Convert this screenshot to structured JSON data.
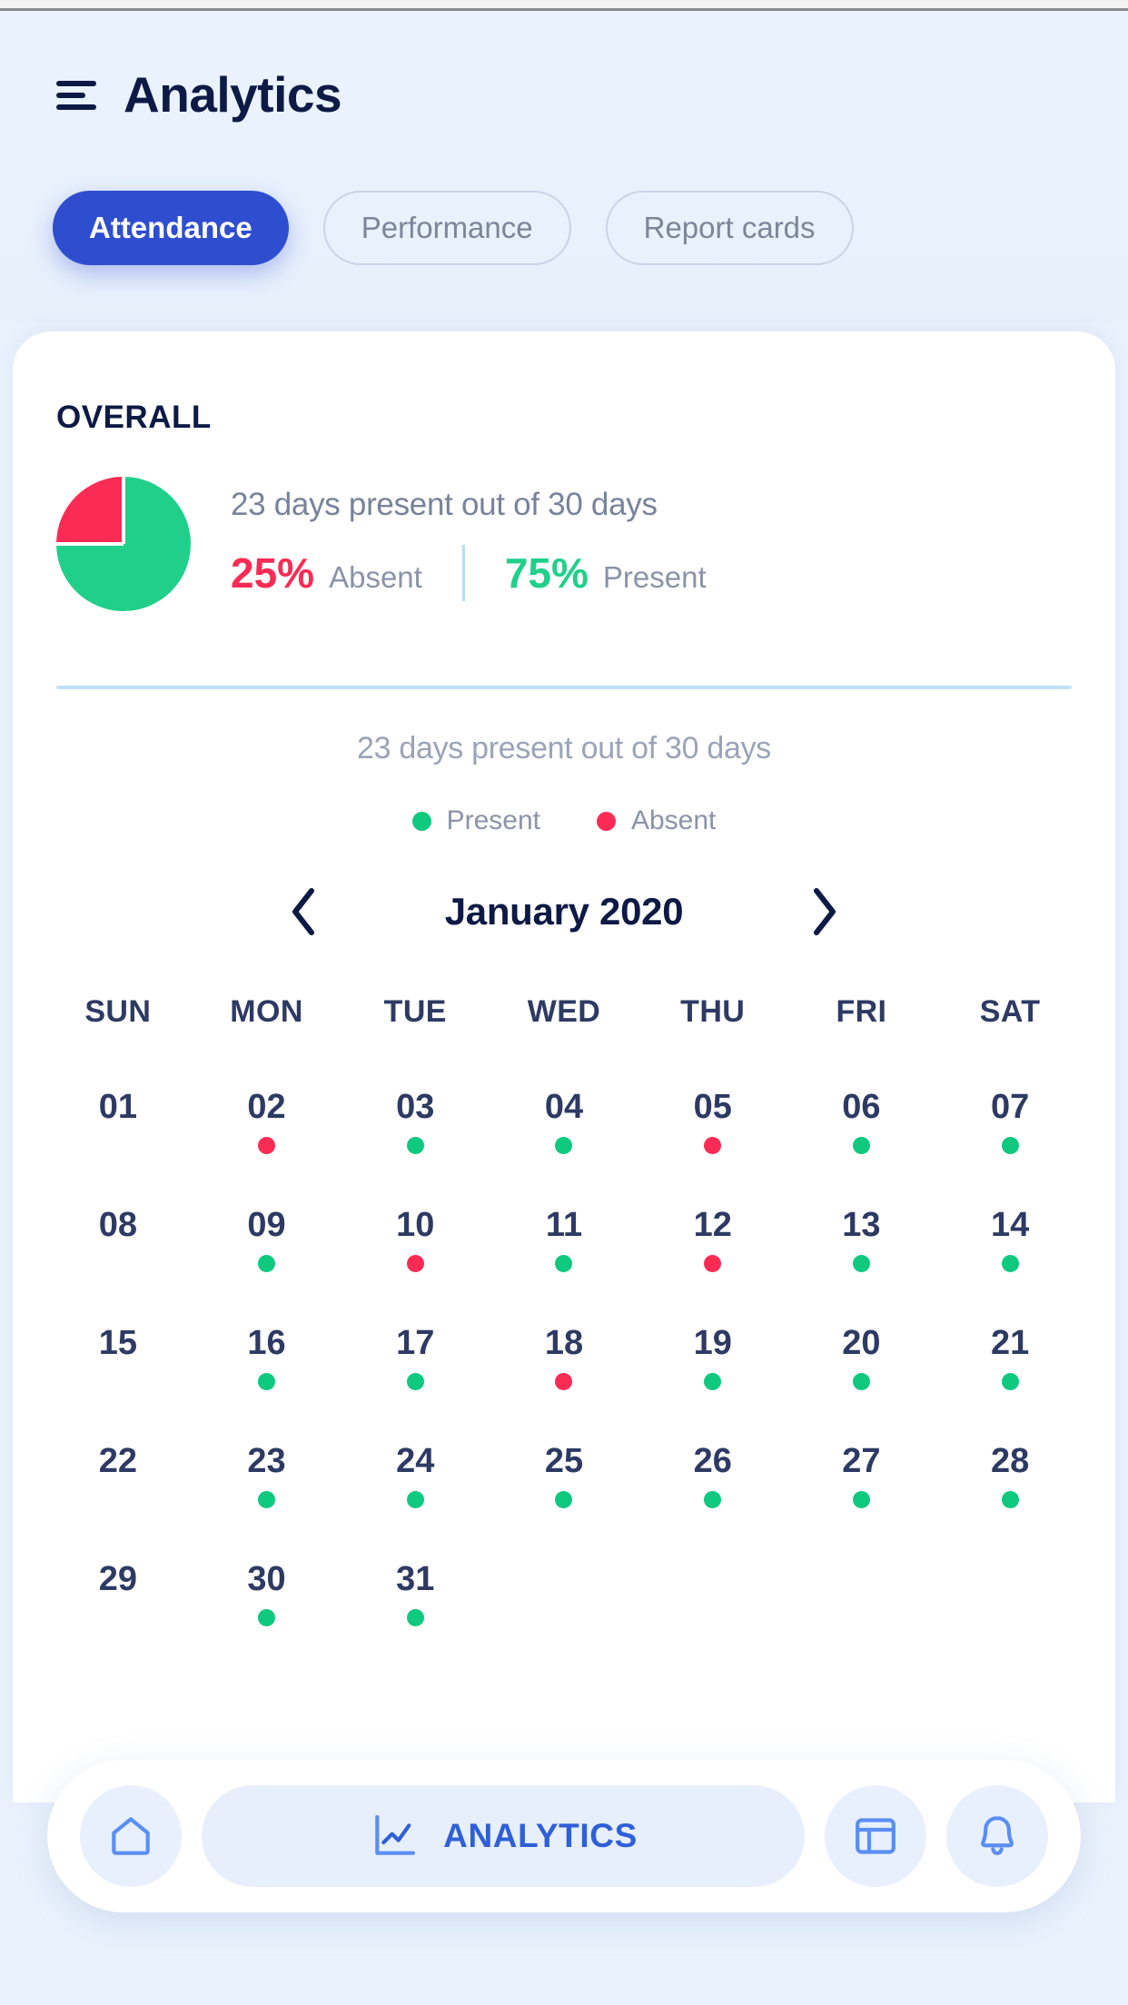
{
  "header": {
    "menu_icon": "hamburger-icon",
    "title": "Analytics",
    "tabs": [
      {
        "label": "Attendance",
        "active": true
      },
      {
        "label": "Performance",
        "active": false
      },
      {
        "label": "Report cards",
        "active": false
      }
    ]
  },
  "overall": {
    "section_label": "OVERALL",
    "days_summary": "23 days present out of 30 days",
    "absent_pct": "25%",
    "absent_label": "Absent",
    "present_pct": "75%",
    "present_label": "Present"
  },
  "calendar": {
    "subtitle": "23 days present out of 30 days",
    "legend": [
      {
        "label": "Present",
        "status": "present"
      },
      {
        "label": "Absent",
        "status": "absent"
      }
    ],
    "prev_icon": "chevron-left-icon",
    "next_icon": "chevron-right-icon",
    "month_label": "January 2020",
    "weekdays": [
      "SUN",
      "MON",
      "TUE",
      "WED",
      "THU",
      "FRI",
      "SAT"
    ],
    "weeks": [
      [
        {
          "day": "01",
          "status": "none"
        },
        {
          "day": "02",
          "status": "absent"
        },
        {
          "day": "03",
          "status": "present"
        },
        {
          "day": "04",
          "status": "present"
        },
        {
          "day": "05",
          "status": "absent"
        },
        {
          "day": "06",
          "status": "present"
        },
        {
          "day": "07",
          "status": "present"
        }
      ],
      [
        {
          "day": "08",
          "status": "none"
        },
        {
          "day": "09",
          "status": "present"
        },
        {
          "day": "10",
          "status": "absent"
        },
        {
          "day": "11",
          "status": "present"
        },
        {
          "day": "12",
          "status": "absent"
        },
        {
          "day": "13",
          "status": "present"
        },
        {
          "day": "14",
          "status": "present"
        }
      ],
      [
        {
          "day": "15",
          "status": "none"
        },
        {
          "day": "16",
          "status": "present"
        },
        {
          "day": "17",
          "status": "present"
        },
        {
          "day": "18",
          "status": "absent"
        },
        {
          "day": "19",
          "status": "present"
        },
        {
          "day": "20",
          "status": "present"
        },
        {
          "day": "21",
          "status": "present"
        }
      ],
      [
        {
          "day": "22",
          "status": "none"
        },
        {
          "day": "23",
          "status": "present"
        },
        {
          "day": "24",
          "status": "present"
        },
        {
          "day": "25",
          "status": "present"
        },
        {
          "day": "26",
          "status": "present"
        },
        {
          "day": "27",
          "status": "present"
        },
        {
          "day": "28",
          "status": "present"
        }
      ],
      [
        {
          "day": "29",
          "status": "none"
        },
        {
          "day": "30",
          "status": "present"
        },
        {
          "day": "31",
          "status": "present"
        },
        {
          "day": "",
          "status": "empty"
        },
        {
          "day": "",
          "status": "empty"
        },
        {
          "day": "",
          "status": "empty"
        },
        {
          "day": "",
          "status": "empty"
        }
      ]
    ]
  },
  "bottom_nav": {
    "items": [
      {
        "icon": "home-icon",
        "label": "",
        "active": false
      },
      {
        "icon": "chart-icon",
        "label": "ANALYTICS",
        "active": true
      },
      {
        "icon": "dashboard-icon",
        "label": "",
        "active": false
      },
      {
        "icon": "bell-icon",
        "label": "",
        "active": false
      }
    ]
  },
  "chart_data": {
    "type": "pie",
    "title": "OVERALL",
    "categories": [
      "Absent",
      "Present"
    ],
    "values": [
      25,
      75
    ],
    "unit": "%",
    "colors": [
      "#fa2b54",
      "#20d08a"
    ],
    "annotation": "23 days present out of 30 days",
    "legend_position": "right"
  },
  "colors": {
    "brand_blue": "#2f4ecf",
    "nav_blue": "#2f5fd8",
    "dark_navy": "#0d1a45",
    "absent_red": "#fa2b54",
    "present_green": "#20d08a",
    "page_bg": "#eaf2fd"
  }
}
